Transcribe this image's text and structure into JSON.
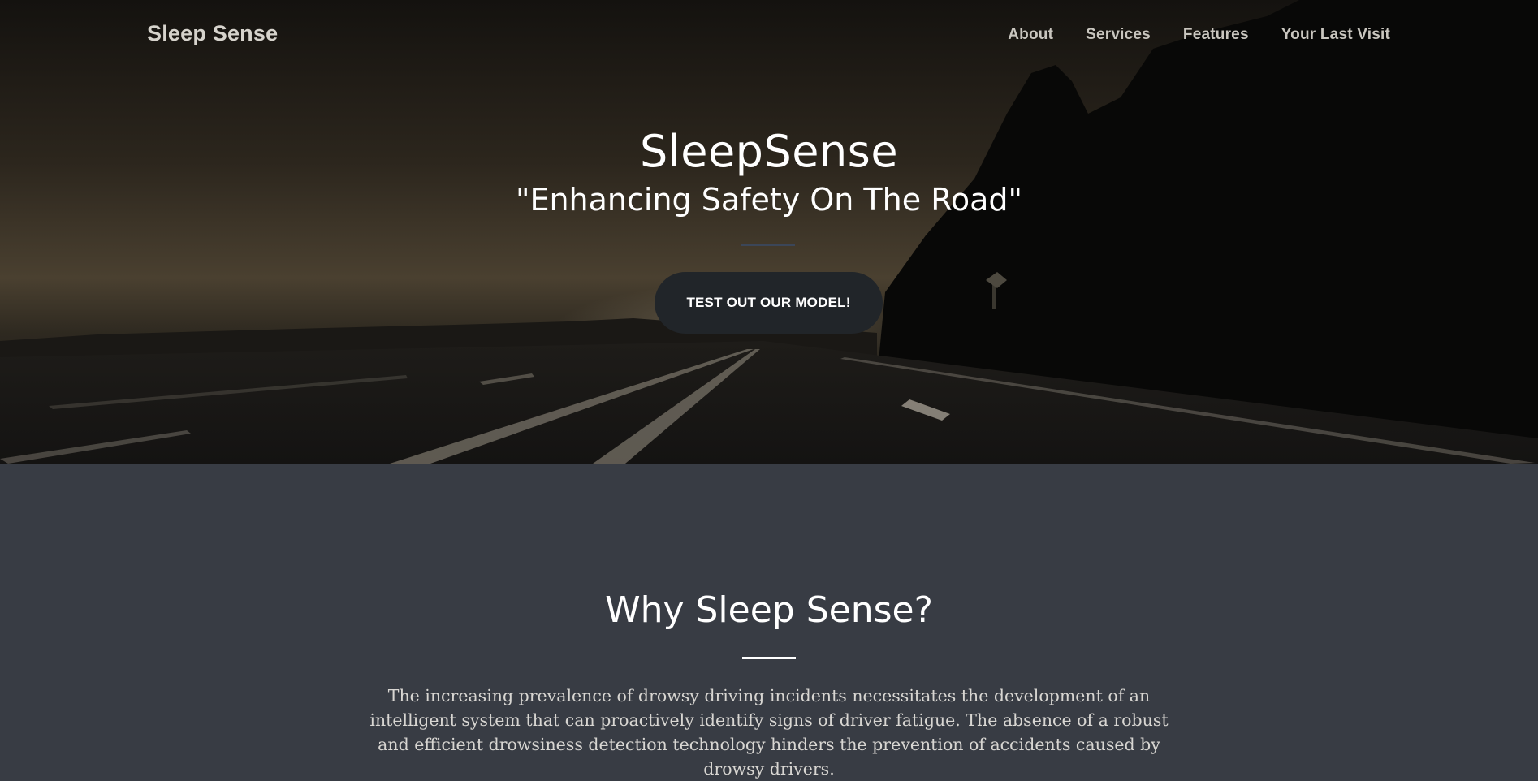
{
  "navbar": {
    "brand": "Sleep Sense",
    "links": [
      "About",
      "Services",
      "Features",
      "Your Last Visit"
    ]
  },
  "hero": {
    "title": "SleepSense",
    "tagline": "\"Enhancing Safety On The Road\"",
    "cta_label": "TEST OUT OUR MODEL!"
  },
  "why": {
    "title": "Why Sleep Sense?",
    "text": "The increasing prevalence of drowsy driving incidents necessitates the development of an intelligent system that can proactively identify signs of driver fatigue. The absence of a robust and efficient drowsiness detection technology hinders the prevention of accidents caused by drowsy drivers."
  },
  "colors": {
    "section_background": "#383c44",
    "button_background": "#212529",
    "hero_divider": "#3b4658",
    "text": "#ffffff"
  }
}
